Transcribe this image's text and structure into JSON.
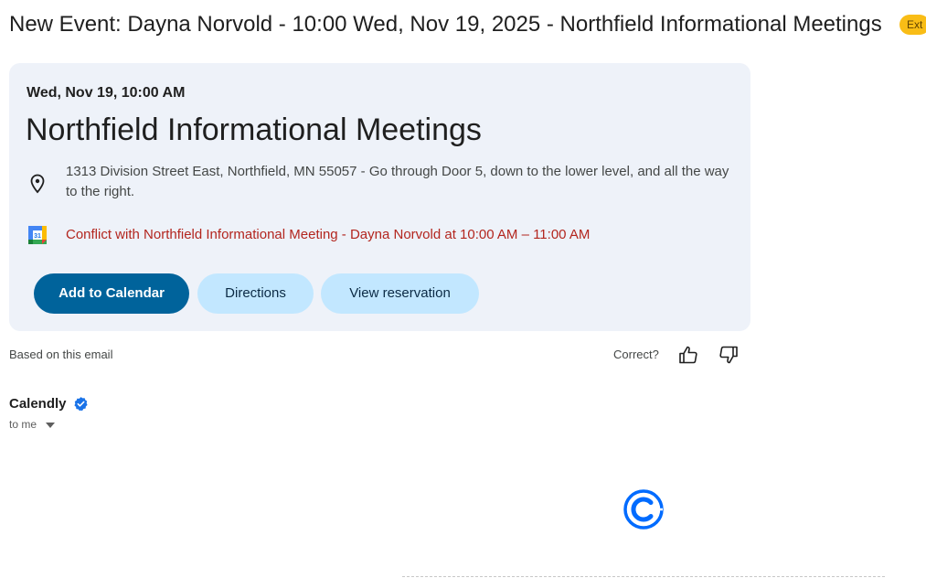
{
  "email": {
    "subject": "New Event: Dayna Norvold - 10:00 Wed, Nov 19, 2025 - Northfield Informational Meetings",
    "label_badge": "Ext"
  },
  "event_card": {
    "date_time": "Wed, Nov 19, 10:00 AM",
    "title": "Northfield Informational Meetings",
    "location": "1313 Division Street East, Northfield, MN 55057 - Go through Door 5, down to the lower level, and all the way to the right.",
    "conflict": "Conflict with Northfield Informational Meeting - Dayna Norvold at 10:00 AM – 11:00 AM",
    "calendar_icon_day": "31",
    "buttons": {
      "add_to_calendar": "Add to Calendar",
      "directions": "Directions",
      "view_reservation": "View reservation"
    }
  },
  "feedback": {
    "based_on": "Based on this email",
    "correct_label": "Correct?"
  },
  "sender": {
    "name": "Calendly",
    "recipient": "to me"
  },
  "icons": {
    "location": "location-pin-icon",
    "calendar": "google-calendar-icon",
    "thumbs_up": "thumbs-up-icon",
    "thumbs_down": "thumbs-down-icon",
    "verified": "verified-badge-icon",
    "caret": "caret-down-icon",
    "logo": "calendly-logo-icon"
  },
  "colors": {
    "card_background": "#eef2f9",
    "primary_button": "#00639b",
    "secondary_button": "#c2e7ff",
    "conflict_text": "#b3261e",
    "badge": "#f9bd16",
    "calendly_blue": "#006bff"
  }
}
